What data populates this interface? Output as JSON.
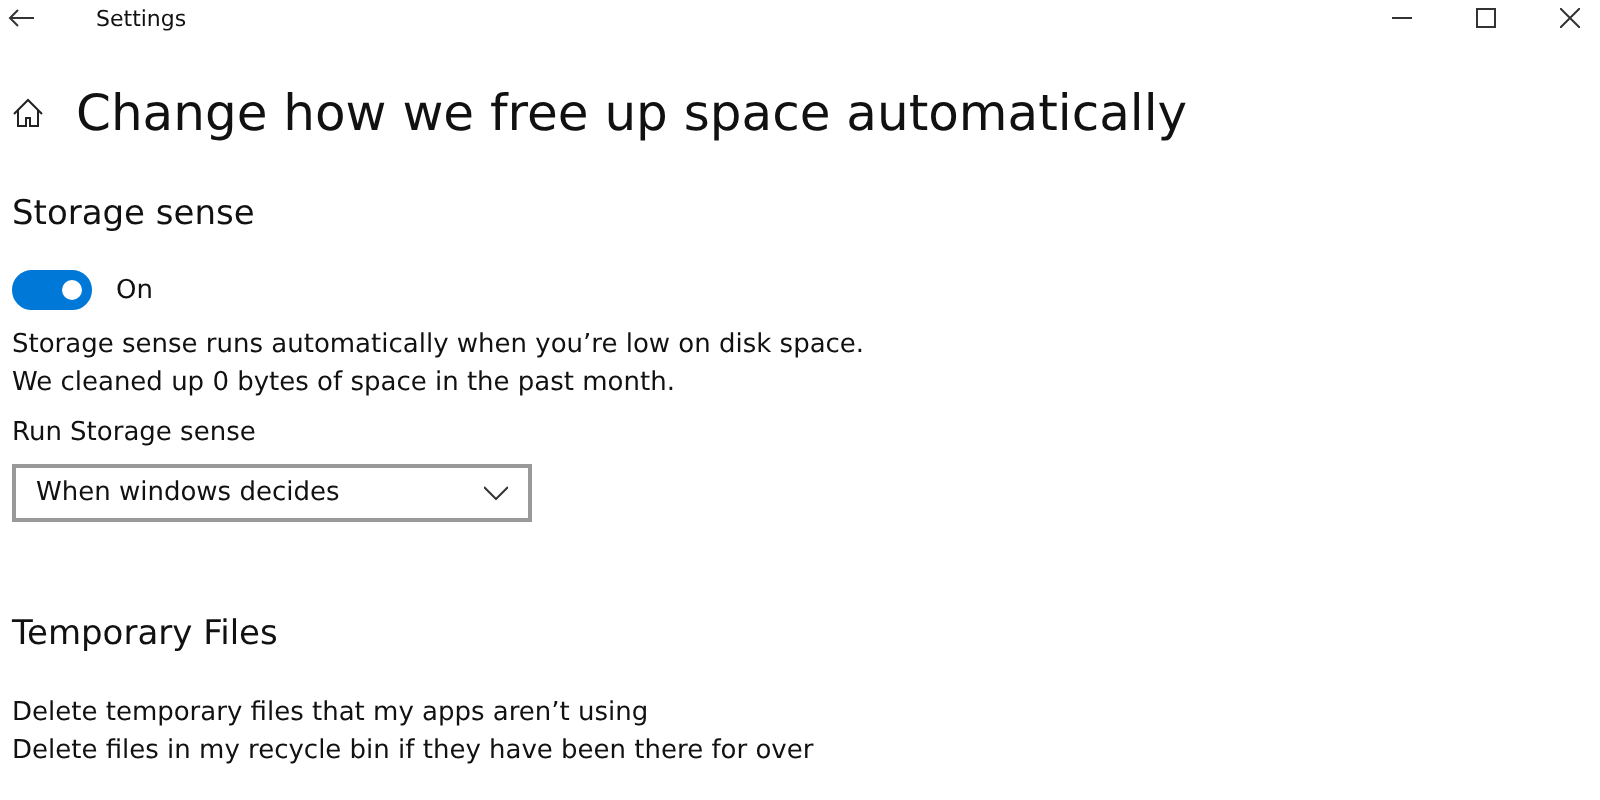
{
  "window": {
    "title": "Settings"
  },
  "page_title": "Change how we free up space automatically",
  "storage_sense": {
    "heading": "Storage sense",
    "toggle": {
      "on": true,
      "label": "On"
    },
    "description": [
      "Storage sense runs automatically when you’re low on disk space.",
      "We cleaned up 0 bytes of space in the past month."
    ],
    "run_label": "Run Storage sense",
    "dropdown": {
      "value": "When windows decides"
    }
  },
  "temporary_files": {
    "heading": "Temporary Files",
    "options": [
      "Delete temporary files that my apps aren’t using",
      "Delete files in my recycle bin if they have been there for over"
    ]
  }
}
